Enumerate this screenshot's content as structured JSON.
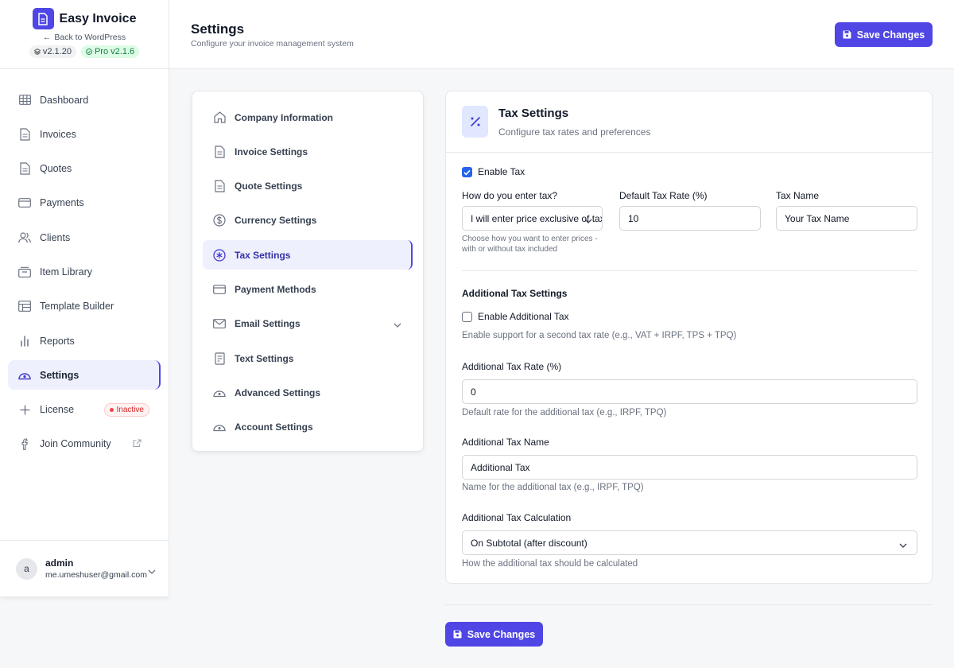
{
  "brand": {
    "title": "Easy Invoice",
    "back_link": "Back to WordPress",
    "version": "v2.1.20",
    "pro_version": "Pro v2.1.6"
  },
  "nav": [
    {
      "label": "Dashboard",
      "icon": "grid-icon"
    },
    {
      "label": "Invoices",
      "icon": "document-icon"
    },
    {
      "label": "Quotes",
      "icon": "document-icon"
    },
    {
      "label": "Payments",
      "icon": "credit-card-icon"
    },
    {
      "label": "Clients",
      "icon": "users-icon"
    },
    {
      "label": "Item Library",
      "icon": "library-icon"
    },
    {
      "label": "Template Builder",
      "icon": "template-icon"
    },
    {
      "label": "Reports",
      "icon": "bar-chart-icon"
    },
    {
      "label": "Settings",
      "icon": "cloud-gear-icon",
      "active": true
    },
    {
      "label": "License",
      "icon": "sparkle-icon",
      "badge": "Inactive"
    },
    {
      "label": "Join Community",
      "icon": "facebook-icon"
    }
  ],
  "user": {
    "initial": "a",
    "name": "admin",
    "email": "me.umeshuser@gmail.com"
  },
  "header": {
    "title": "Settings",
    "subtitle": "Configure your invoice management system",
    "save_label": "Save Changes"
  },
  "settings_menu": [
    {
      "label": "Company Information",
      "icon": "home-icon"
    },
    {
      "label": "Invoice Settings",
      "icon": "document-icon"
    },
    {
      "label": "Quote Settings",
      "icon": "document-icon"
    },
    {
      "label": "Currency Settings",
      "icon": "dollar-icon"
    },
    {
      "label": "Tax Settings",
      "icon": "asterisk-icon",
      "active": true
    },
    {
      "label": "Payment Methods",
      "icon": "credit-card-icon"
    },
    {
      "label": "Email Settings",
      "icon": "mail-icon",
      "expandable": true
    },
    {
      "label": "Text Settings",
      "icon": "text-file-icon"
    },
    {
      "label": "Advanced Settings",
      "icon": "cloud-gear-icon"
    },
    {
      "label": "Account Settings",
      "icon": "cloud-gear-icon"
    }
  ],
  "tax": {
    "title": "Tax Settings",
    "subtitle": "Configure tax rates and preferences",
    "enable_tax_label": "Enable Tax",
    "enable_tax_checked": true,
    "entry_label": "How do you enter tax?",
    "entry_value": "I will enter price exclusive of tax",
    "entry_help": "Choose how you want to enter prices - with or without tax included",
    "rate_label": "Default Tax Rate (%)",
    "rate_value": "10",
    "name_label": "Tax Name",
    "name_value": "Your Tax Name",
    "additional_title": "Additional Tax Settings",
    "enable_additional_label": "Enable Additional Tax",
    "enable_additional_checked": false,
    "enable_additional_help": "Enable support for a second tax rate (e.g., VAT + IRPF, TPS + TPQ)",
    "add_rate_label": "Additional Tax Rate (%)",
    "add_rate_value": "0",
    "add_rate_help": "Default rate for the additional tax (e.g., IRPF, TPQ)",
    "add_name_label": "Additional Tax Name",
    "add_name_value": "Additional Tax",
    "add_name_help": "Name for the additional tax (e.g., IRPF, TPQ)",
    "add_calc_label": "Additional Tax Calculation",
    "add_calc_value": "On Subtotal (after discount)",
    "add_calc_help": "How the additional tax should be calculated"
  },
  "footer": {
    "save_label": "Save Changes"
  },
  "colors": {
    "accent": "#4f46e5",
    "active_bg": "#eef0fe",
    "checkbox": "#2563eb",
    "inactive_red": "#dc2626"
  }
}
